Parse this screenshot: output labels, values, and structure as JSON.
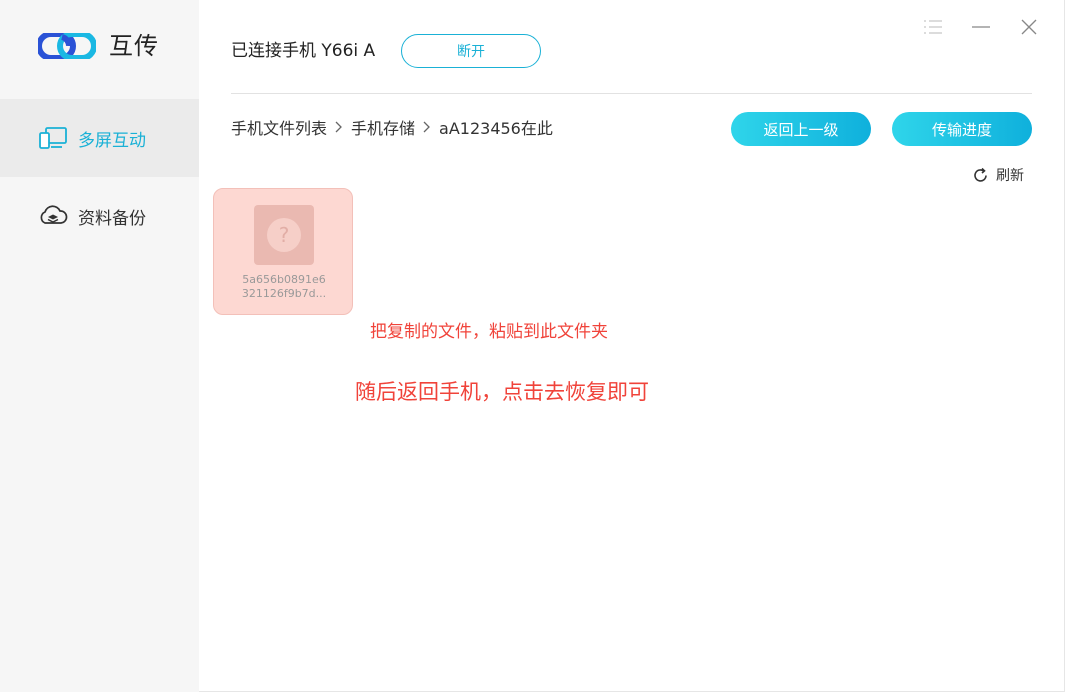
{
  "app": {
    "name": "互传",
    "brand_color": "#1ab1d6",
    "logo_colors": [
      "#2a52d6",
      "#1ab8e3"
    ]
  },
  "sidebar": {
    "items": [
      {
        "label": "多屏互动",
        "icon": "multiscreen-icon",
        "active": true
      },
      {
        "label": "资料备份",
        "icon": "cloud-backup-icon",
        "active": false
      }
    ]
  },
  "window_controls": [
    "menu-icon",
    "minimize-icon",
    "close-icon"
  ],
  "header": {
    "connection_status": "已连接手机 Y66i A",
    "disconnect_label": "断开"
  },
  "breadcrumb": [
    "手机文件列表",
    "手机存储",
    "aA123456在此"
  ],
  "toolbar": {
    "back_label": "返回上一级",
    "progress_label": "传输进度",
    "refresh_label": "刷新"
  },
  "files": [
    {
      "name_line1": "5a656b0891e6",
      "name_line2": "321126f9b7d...",
      "icon": "unknown-file-icon"
    }
  ],
  "annotations": {
    "line1": "把复制的文件，粘贴到此文件夹",
    "line2": "随后返回手机，点击去恢复即可",
    "color": "#f0433a"
  }
}
